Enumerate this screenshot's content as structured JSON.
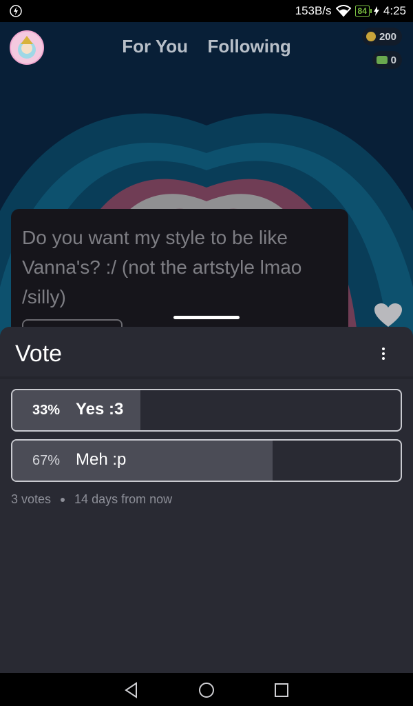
{
  "status_bar": {
    "net_speed": "153B/s",
    "battery_level": "84",
    "time": "4:25",
    "icons": [
      "charging-bolt-icon",
      "wifi-icon",
      "battery-icon"
    ]
  },
  "header": {
    "tabs": [
      {
        "label": "For You"
      },
      {
        "label": "Following"
      }
    ],
    "coins": "200",
    "cash": "0"
  },
  "post": {
    "text": "Do you want my style to be like Vanna's? :/ (not the artstyle lmao /silly)"
  },
  "poll": {
    "title": "Vote",
    "options": [
      {
        "percent": "33%",
        "label": "Yes :3",
        "fraction": 0.33,
        "selected": true
      },
      {
        "percent": "67%",
        "label": "Meh :p",
        "fraction": 0.67,
        "selected": false
      }
    ],
    "votes": "3 votes",
    "time_left": "14 days from now"
  },
  "colors": {
    "sheet_bg": "#292a33",
    "option_fill": "#4b4c56",
    "background_blue": "#0a2d52",
    "heart_pink": "#9b5a78"
  }
}
